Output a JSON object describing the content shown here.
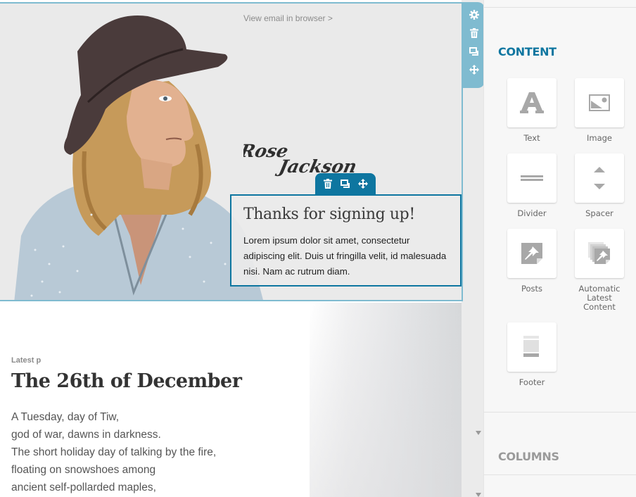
{
  "email": {
    "view_in_browser": "View email in browser >",
    "signature": "Rose Jackson",
    "text_block": {
      "heading": "Thanks for signing up!",
      "body": "Lorem ipsum dolor sit amet, consectetur adipiscing elit. Duis ut fringilla velit, id malesuada nisi. Nam ac rutrum diam."
    },
    "posts": {
      "label": "Latest p",
      "title": "The 26th of December",
      "lines": [
        "A Tuesday, day of Tiw,",
        "god of war, dawns in darkness.",
        "The short holiday day of talking by the fire,",
        "floating on snowshoes among",
        "ancient self-pollarded maples,"
      ]
    }
  },
  "row_tools": {
    "icons": [
      "gear-icon",
      "trash-icon",
      "duplicate-icon",
      "move-icon"
    ]
  },
  "block_tools": {
    "icons": [
      "trash-icon",
      "duplicate-icon",
      "move-icon"
    ]
  },
  "sidebar": {
    "content_title": "CONTENT",
    "widgets": [
      {
        "label": "Text",
        "icon": "text-icon"
      },
      {
        "label": "Image",
        "icon": "image-icon"
      },
      {
        "label": "Divider",
        "icon": "divider-icon"
      },
      {
        "label": "Spacer",
        "icon": "spacer-icon"
      },
      {
        "label": "Posts",
        "icon": "posts-icon"
      },
      {
        "label": "Automatic Latest Content",
        "icon": "automatic-latest-content-icon"
      },
      {
        "label": "Footer",
        "icon": "footer-icon"
      }
    ],
    "columns_title": "COLUMNS"
  },
  "colors": {
    "accent": "#0e76a0",
    "row_highlight": "#7fbbd0",
    "icon_grey": "#a8a8a8"
  }
}
